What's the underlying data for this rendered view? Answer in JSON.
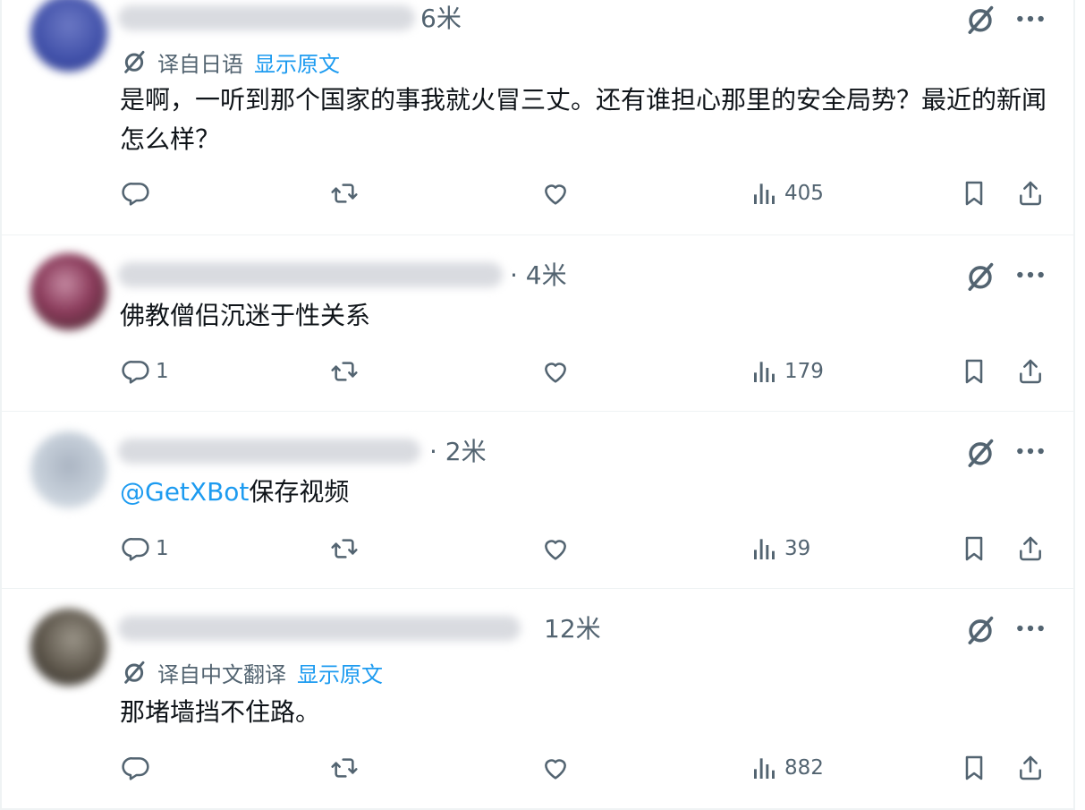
{
  "colors": {
    "link": "#1d9bf0",
    "muted": "#536471",
    "text": "#0f1419",
    "divider": "#eff3f4"
  },
  "icons": {
    "reply": "speech-bubble-icon",
    "retweet": "retweet-icon",
    "like": "heart-icon",
    "views": "bar-chart-icon",
    "bookmark": "bookmark-icon",
    "share": "share-icon",
    "grok": "grok-slash-icon",
    "more": "ellipsis-icon",
    "translate": "translate-icon"
  },
  "tweets": [
    {
      "time": "6米",
      "translation": {
        "label": "译自日语",
        "show_original": "显示原文"
      },
      "text": "是啊，一听到那个国家的事我就火冒三丈。还有谁担心那里的安全局势？最近的新闻怎么样？",
      "replies": "",
      "views": "405"
    },
    {
      "time": "· 4米",
      "text": "佛教僧侣沉迷于性关系",
      "replies": "1",
      "views": "179"
    },
    {
      "time": "· 2米",
      "mention": "@GetXBot",
      "text": "保存视频",
      "replies": "1",
      "views": "39"
    },
    {
      "time": "12米",
      "translation": {
        "label": "译自中文翻译",
        "show_original": "显示原文"
      },
      "text": "那堵墙挡不住路。",
      "replies": "",
      "views": "882"
    }
  ]
}
